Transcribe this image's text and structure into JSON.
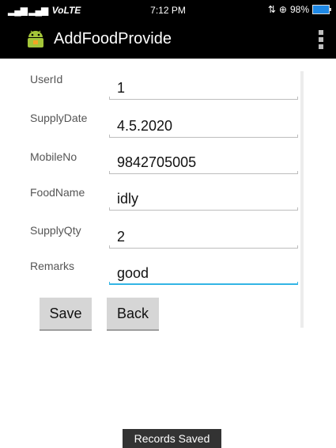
{
  "status_bar": {
    "network": "VoLTE",
    "time": "7:12 PM",
    "battery": "98%"
  },
  "action_bar": {
    "title": "AddFoodProvide",
    "icon": "android-icon"
  },
  "form": {
    "fields": [
      {
        "label": "UserId",
        "value": "1"
      },
      {
        "label": "SupplyDate",
        "value": "4.5.2020"
      },
      {
        "label": "MobileNo",
        "value": "9842705005"
      },
      {
        "label": "FoodName",
        "value": "idly"
      },
      {
        "label": "SupplyQty",
        "value": "2"
      },
      {
        "label": "Remarks",
        "value": "good"
      }
    ]
  },
  "buttons": {
    "save": "Save",
    "back": "Back"
  },
  "toast": "Records Saved",
  "colors": {
    "focus_accent": "#33b5e5",
    "battery": "#1e88e5",
    "bar_background": "#000000"
  }
}
